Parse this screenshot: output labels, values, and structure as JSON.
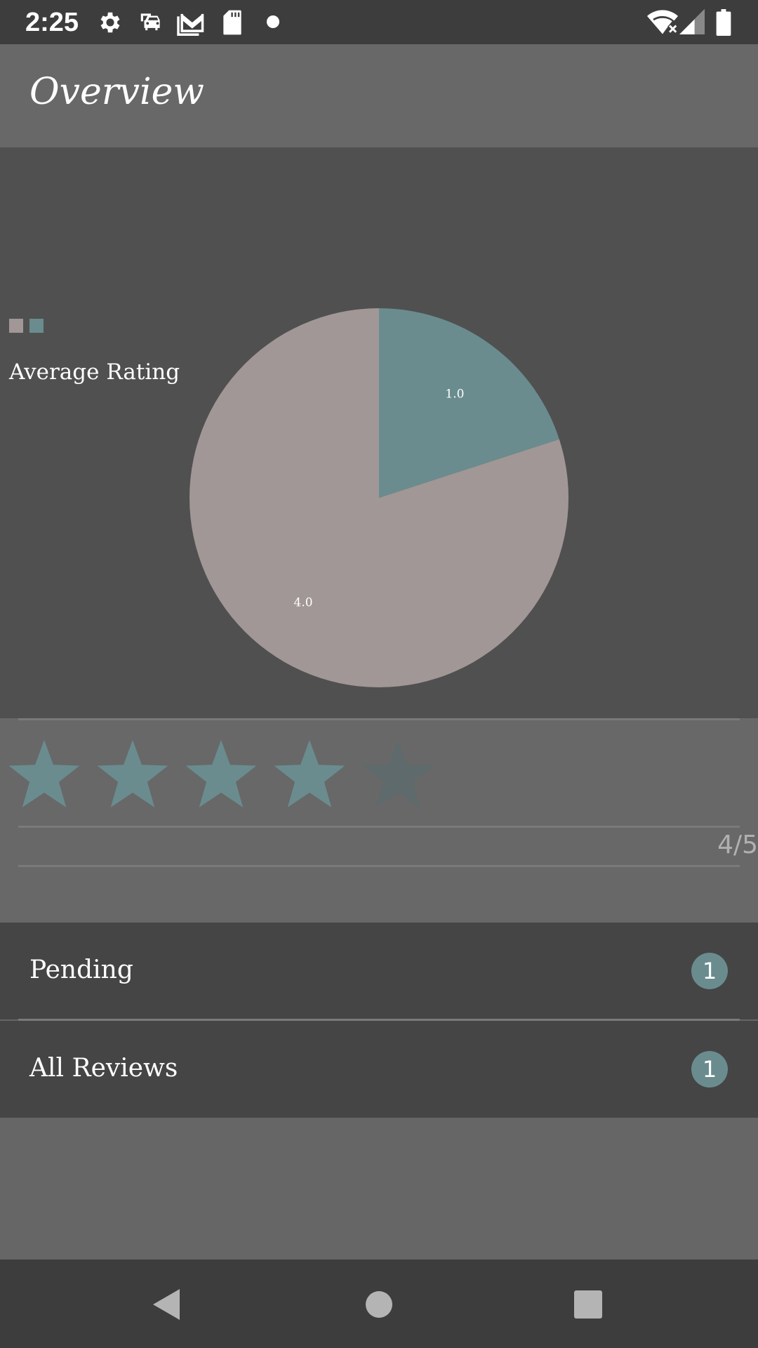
{
  "status_bar": {
    "time": "2:25",
    "icons": [
      "gear-icon",
      "car-icon",
      "gmail-icon",
      "sd-card-icon",
      "dot-icon",
      "wifi-off-icon",
      "signal-icon",
      "battery-icon"
    ]
  },
  "header": {
    "title": "Overview"
  },
  "chart_data": {
    "type": "pie",
    "title": "Average Rating",
    "slices": [
      {
        "value": 4.0,
        "label": "4.0",
        "color": "#a19796"
      },
      {
        "value": 1.0,
        "label": "1.0",
        "color": "#6a8c8e"
      }
    ],
    "legend": "top-left"
  },
  "rating": {
    "value": 4,
    "max": 5,
    "text": "4/5",
    "filled_color": "#6a8c8e",
    "empty_color": "#5e6a6b"
  },
  "lists": {
    "pending": {
      "label": "Pending",
      "count": "1"
    },
    "all_reviews": {
      "label": "All Reviews",
      "count": "1"
    }
  },
  "nav": {
    "buttons": [
      "back-icon",
      "home-icon",
      "recents-icon"
    ]
  },
  "colors": {
    "accent": "#6a8c8e",
    "pie_major": "#a19796"
  }
}
